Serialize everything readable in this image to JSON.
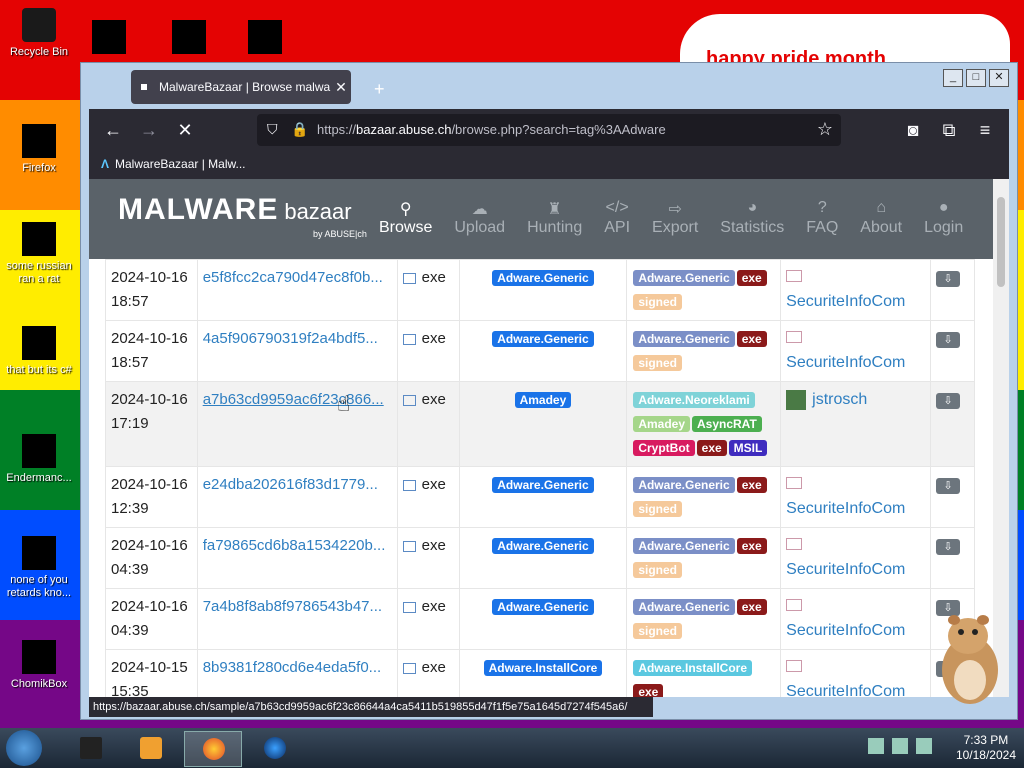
{
  "desktop": {
    "stripe_colors": [
      "#e40303",
      "#ff8c00",
      "#ffed00",
      "#008026",
      "#004dff",
      "#750787"
    ],
    "icons": [
      {
        "label": "Recycle Bin",
        "icon": "recycle-bin-icon"
      },
      {
        "label": "Firefox",
        "icon": "firefox-icon"
      },
      {
        "label": "some russian ran a rat",
        "icon": "file-icon"
      },
      {
        "label": "that but its c#",
        "icon": "file-icon"
      },
      {
        "label": "Endermanc...",
        "icon": "app-icon"
      },
      {
        "label": "none of you retards kno...",
        "icon": "app-icon"
      },
      {
        "label": "ChomikBox",
        "icon": "chomikbox-icon"
      }
    ],
    "banner_text": "happy pride month"
  },
  "browser": {
    "tab_title": "MalwareBazaar | Browse malwa",
    "url_prefix": "https://",
    "url_host": "bazaar.abuse.ch",
    "url_path": "/browse.php?search=tag%3AAdware",
    "bookmark": "MalwareBazaar | Malw...",
    "status_url": "https://bazaar.abuse.ch/sample/a7b63cd9959ac6f23c86644a4ca5411b519855d47f1f5e75a1645d7274f545a6/"
  },
  "site": {
    "logo_main": "MALWARE",
    "logo_sub": "bazaar",
    "logo_by": "by ABUSE|ch",
    "nav": [
      {
        "label": "Browse",
        "icon": "search-icon"
      },
      {
        "label": "Upload",
        "icon": "cloud-upload-icon"
      },
      {
        "label": "Hunting",
        "icon": "chess-rook-icon"
      },
      {
        "label": "API",
        "icon": "code-icon"
      },
      {
        "label": "Export",
        "icon": "export-icon"
      },
      {
        "label": "Statistics",
        "icon": "pie-chart-icon"
      },
      {
        "label": "FAQ",
        "icon": "question-icon"
      },
      {
        "label": "About",
        "icon": "building-icon"
      },
      {
        "label": "Login",
        "icon": "user-icon"
      }
    ]
  },
  "rows": [
    {
      "date": "2024-10-16",
      "time": "18:57",
      "hash": "e5f8fcc2ca790d47ec8f0b...",
      "type": "exe",
      "signature": {
        "text": "Adware.Generic",
        "color": "#1a73e8"
      },
      "tags": [
        {
          "text": "Adware.Generic",
          "color": "#7b8fc7"
        },
        {
          "text": "exe",
          "color": "#8b1a1a"
        },
        {
          "text": "signed",
          "color": "#f5c99b"
        }
      ],
      "reporter": "SecuriteInfoCom"
    },
    {
      "date": "2024-10-16",
      "time": "18:57",
      "hash": "4a5f906790319f2a4bdf5...",
      "type": "exe",
      "signature": {
        "text": "Adware.Generic",
        "color": "#1a73e8"
      },
      "tags": [
        {
          "text": "Adware.Generic",
          "color": "#7b8fc7"
        },
        {
          "text": "exe",
          "color": "#8b1a1a"
        },
        {
          "text": "signed",
          "color": "#f5c99b"
        }
      ],
      "reporter": "SecuriteInfoCom"
    },
    {
      "date": "2024-10-16",
      "time": "17:19",
      "hash": "a7b63cd9959ac6f23c866...",
      "type": "exe",
      "signature": {
        "text": "Amadey",
        "color": "#1a73e8"
      },
      "tags": [
        {
          "text": "Adware.Neoreklami",
          "color": "#7fd3d8"
        },
        {
          "text": "Amadey",
          "color": "#a5d68a"
        },
        {
          "text": "AsyncRAT",
          "color": "#4caf50"
        },
        {
          "text": "CryptBot",
          "color": "#d81b60"
        },
        {
          "text": "exe",
          "color": "#8b1a1a"
        },
        {
          "text": "MSIL",
          "color": "#3f2cbf"
        }
      ],
      "reporter": "jstrosch",
      "highlight": true
    },
    {
      "date": "2024-10-16",
      "time": "12:39",
      "hash": "e24dba202616f83d1779...",
      "type": "exe",
      "signature": {
        "text": "Adware.Generic",
        "color": "#1a73e8"
      },
      "tags": [
        {
          "text": "Adware.Generic",
          "color": "#7b8fc7"
        },
        {
          "text": "exe",
          "color": "#8b1a1a"
        },
        {
          "text": "signed",
          "color": "#f5c99b"
        }
      ],
      "reporter": "SecuriteInfoCom"
    },
    {
      "date": "2024-10-16",
      "time": "04:39",
      "hash": "fa79865cd6b8a1534220b...",
      "type": "exe",
      "signature": {
        "text": "Adware.Generic",
        "color": "#1a73e8"
      },
      "tags": [
        {
          "text": "Adware.Generic",
          "color": "#7b8fc7"
        },
        {
          "text": "exe",
          "color": "#8b1a1a"
        },
        {
          "text": "signed",
          "color": "#f5c99b"
        }
      ],
      "reporter": "SecuriteInfoCom"
    },
    {
      "date": "2024-10-16",
      "time": "04:39",
      "hash": "7a4b8f8ab8f9786543b47...",
      "type": "exe",
      "signature": {
        "text": "Adware.Generic",
        "color": "#1a73e8"
      },
      "tags": [
        {
          "text": "Adware.Generic",
          "color": "#7b8fc7"
        },
        {
          "text": "exe",
          "color": "#8b1a1a"
        },
        {
          "text": "signed",
          "color": "#f5c99b"
        }
      ],
      "reporter": "SecuriteInfoCom"
    },
    {
      "date": "2024-10-15",
      "time": "15:35",
      "hash": "8b9381f280cd6e4eda5f0...",
      "type": "exe",
      "signature": {
        "text": "Adware.InstallCore",
        "color": "#1a73e8"
      },
      "tags": [
        {
          "text": "Adware.InstallCore",
          "color": "#5bc8e0"
        },
        {
          "text": "exe",
          "color": "#8b1a1a"
        }
      ],
      "reporter": "SecuriteInfoCom"
    }
  ],
  "taskbar": {
    "time": "7:33 PM",
    "date": "10/18/2024"
  }
}
